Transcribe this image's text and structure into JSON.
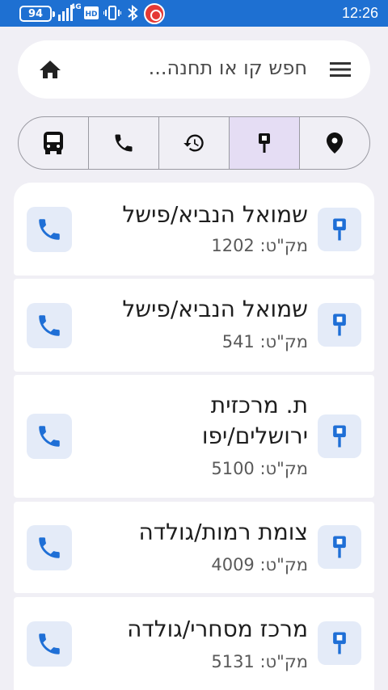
{
  "status": {
    "battery": "94",
    "network": "4G",
    "time": "12:26"
  },
  "search": {
    "placeholder": "חפש קו או תחנה..."
  },
  "tabs": [
    {
      "icon": "bus-icon"
    },
    {
      "icon": "phone-icon"
    },
    {
      "icon": "history-icon"
    },
    {
      "icon": "bus-stop-icon",
      "active": true
    },
    {
      "icon": "location-pin-icon"
    }
  ],
  "stops": [
    {
      "name": "שמואל הנביא/פישל",
      "code": "מק\"ט: 1202"
    },
    {
      "name": "שמואל הנביא/פישל",
      "code": "מק\"ט: 541"
    },
    {
      "name_line1": "ת. מרכזית",
      "name_line2": "ירושלים/יפו",
      "code": "מק\"ט: 5100"
    },
    {
      "name": "צומת רמות/גולדה",
      "code": "מק\"ט: 4009"
    },
    {
      "name": "מרכז מסחרי/גולדה",
      "code": "מק\"ט: 5131"
    }
  ],
  "colors": {
    "status_bar": "#1e70d2",
    "accent_blue": "#1f6fd6",
    "active_tab": "#e5ddf4",
    "icon_bg": "#e4ebf8"
  }
}
